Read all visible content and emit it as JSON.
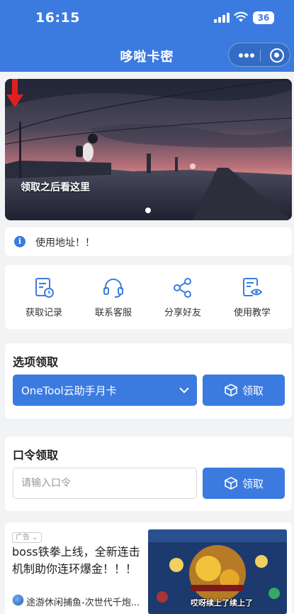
{
  "status_bar": {
    "time": "16:15",
    "battery": "36"
  },
  "nav": {
    "title": "哆啦卡密"
  },
  "banner": {
    "caption": "领取之后看这里"
  },
  "notice": {
    "icon": "info-icon",
    "text": "使用地址！！"
  },
  "quick_actions": [
    {
      "label": "获取记录",
      "icon": "record-icon"
    },
    {
      "label": "联系客服",
      "icon": "headset-icon"
    },
    {
      "label": "分享好友",
      "icon": "share-icon"
    },
    {
      "label": "使用教学",
      "icon": "tutorial-icon"
    }
  ],
  "select_claim": {
    "title": "选项领取",
    "selected": "OneTool云助手月卡",
    "button": "领取"
  },
  "password_claim": {
    "title": "口令领取",
    "placeholder": "请输入口令",
    "button": "领取"
  },
  "ad": {
    "tag": "广告",
    "title": "boss铁拳上线，全新连击机制助你连环爆金！！！",
    "source": "途游休闲捕鱼-次世代千炮...",
    "image_caption": "哎呀续上了续上了"
  },
  "colors": {
    "brand": "#3b7be0",
    "page_bg": "#f2f3f5"
  }
}
